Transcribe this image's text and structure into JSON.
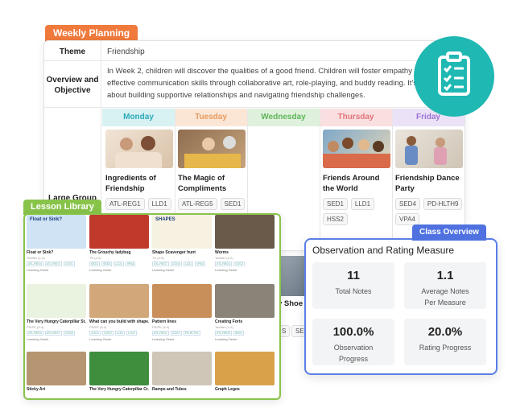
{
  "weekly_planning": {
    "tag": "Weekly Planning",
    "theme_label": "Theme",
    "theme_value": "Friendship",
    "overview_label": "Overview and Objective",
    "overview_text": "In Week 2, children will discover the qualities of a good friend. Children will foster empathy and effective communication skills through collaborative art, role-playing, and buddy reading. It's all about building supportive relationships and navigating friendship challenges.",
    "large_group_label": "Large Group",
    "days": [
      {
        "name": "Monday",
        "color": "#2aa9b8",
        "bg": "#d8f1f3"
      },
      {
        "name": "Tuesday",
        "color": "#e89a5d",
        "bg": "#fbe6d6"
      },
      {
        "name": "Wednesday",
        "color": "#5fb65a",
        "bg": "#dff1dc"
      },
      {
        "name": "Thursday",
        "color": "#e0747a",
        "bg": "#fadfe0"
      },
      {
        "name": "Friday",
        "color": "#9b73d4",
        "bg": "#ebe2f8"
      }
    ],
    "activities": [
      {
        "title": "Ingredients of Friendship",
        "chips": [
          "ATL-REG1",
          "LLD1"
        ]
      },
      {
        "title": "The Magic of Compliments",
        "chips": [
          "ATL-REG5",
          "SED1"
        ]
      },
      {
        "title": "",
        "chips": []
      },
      {
        "title": "Friends Around the World",
        "chips": [
          "SED1",
          "LLD1",
          "HSS2"
        ]
      },
      {
        "title": "Friendship Dance Party",
        "chips": [
          "SED4",
          "PD-HLTH9",
          "VPA4"
        ]
      }
    ]
  },
  "lesson_library": {
    "tag": "Lesson Library",
    "tiles": [
      {
        "title": "Float or Sink?",
        "sub": "Toddler (1-2)",
        "chips": [
          "ATL-REG4",
          "ATL-REG7",
          "COG1"
        ],
        "foot": "Learning Genie",
        "img": "#cfe3f5",
        "txt": "Float or Sink?"
      },
      {
        "title": "The Grouchy ladybug",
        "sub": "TK (4-5)",
        "chips": [
          "SED1",
          "SED3",
          "LLD1",
          "VPA3"
        ],
        "foot": "Learning Genie",
        "img": "#c0392b",
        "txt": ""
      },
      {
        "title": "Shape Scavenger hunt",
        "sub": "TK (4-5)",
        "chips": [
          "ATL-REG7",
          "COG4",
          "LLD1",
          "VPA2"
        ],
        "foot": "Learning Genie",
        "img": "#f6f1e0",
        "txt": "SHAPES"
      },
      {
        "title": "Worms",
        "sub": "Toddler (1-2)",
        "chips": [
          "ATL-REG4",
          "COG2"
        ],
        "foot": "Learning Genie",
        "img": "#6a5a4a",
        "txt": ""
      },
      {
        "title": "The Very Hungry Caterpillar St...",
        "sub": "PS/PK (3-4)",
        "chips": [
          "ATL-REG4",
          "ATL-REG7",
          "COG5"
        ],
        "foot": "Learning Genie",
        "img": "#eaf2e0",
        "txt": ""
      },
      {
        "title": "What can you build with shape...",
        "sub": "PS/PK (3-4)",
        "chips": [
          "COG1",
          "COG2",
          "LLD1",
          "LLD2"
        ],
        "foot": "Learning Genie",
        "img": "#d2a77a",
        "txt": ""
      },
      {
        "title": "Pattern lines",
        "sub": "PS/PK (3-4)",
        "chips": [
          "ATL-REG1",
          "COG7",
          "PD-HLTH1"
        ],
        "foot": "Learning Genie",
        "img": "#c98f5a",
        "txt": ""
      },
      {
        "title": "Creating Forts",
        "sub": "Toddler (1-2)",
        "chips": [
          "ATL-REG4",
          "SED1"
        ],
        "foot": "Learning Genie",
        "img": "#8a8378",
        "txt": ""
      },
      {
        "title": "Sticky Art",
        "sub": "",
        "chips": [],
        "foot": "",
        "img": "#b59572",
        "txt": ""
      },
      {
        "title": "The Very Hungry Caterpillar Cr...",
        "sub": "",
        "chips": [],
        "foot": "",
        "img": "#3e8e3e",
        "txt": ""
      },
      {
        "title": "Ramps and Tubes",
        "sub": "",
        "chips": [],
        "foot": "",
        "img": "#cfc6b8",
        "txt": ""
      },
      {
        "title": "Graph Legos",
        "sub": "",
        "chips": [],
        "foot": "",
        "img": "#d9a24a",
        "txt": ""
      }
    ]
  },
  "class_overview": {
    "tag": "Class Overview",
    "title": "Observation and Rating Measure",
    "stats": [
      {
        "value": "11",
        "label": "Total Notes"
      },
      {
        "value": "1.1",
        "label": "Average Notes Per Measure"
      },
      {
        "value": "100.0%",
        "label": "Observation Progress"
      },
      {
        "value": "20.0%",
        "label": "Rating Progress"
      }
    ]
  },
  "partial_text": {
    "shoe": "y Shoe",
    "chip_s": "S",
    "chip_sed": "SED"
  }
}
